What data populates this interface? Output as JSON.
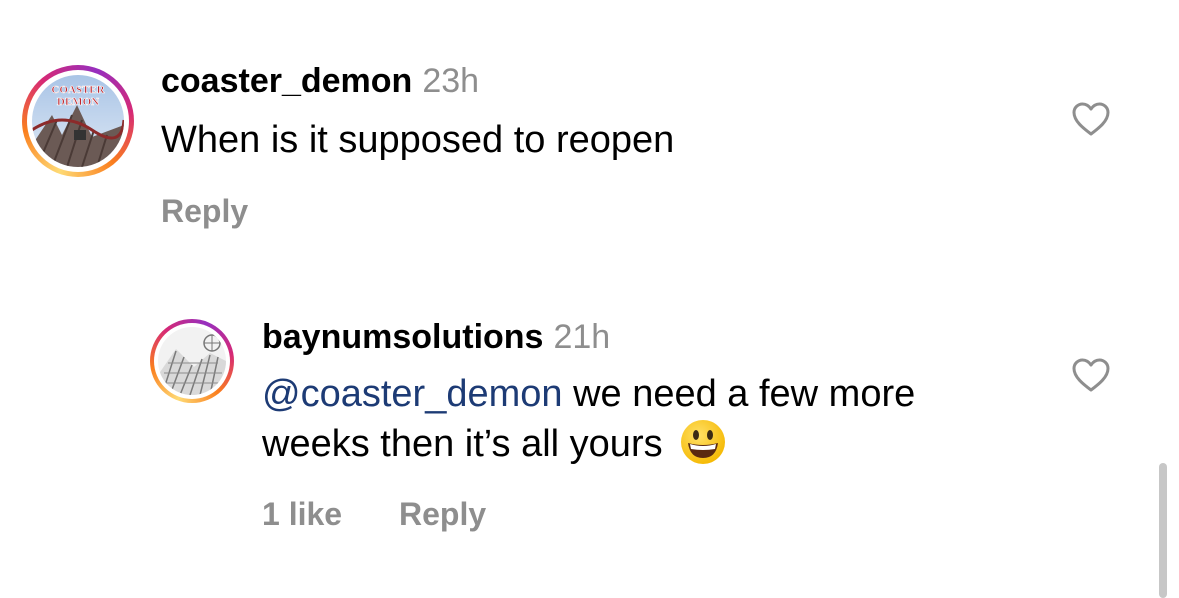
{
  "comments": [
    {
      "username": "coaster_demon",
      "time": "23h",
      "text": "When is it supposed to reopen",
      "reply_label": "Reply",
      "avatar_text": "COASTER DEMON"
    },
    {
      "username": "baynumsolutions",
      "time": "21h",
      "mention": "@coaster_demon",
      "text_line1": " we need a few more",
      "text_line2": "weeks then it’s all yours",
      "likes": "1 like",
      "reply_label": "Reply"
    }
  ],
  "colors": {
    "secondary_text": "#8e8e8e",
    "mention": "#1d3b75",
    "story_ring": [
      "#feda75",
      "#fa7e1e",
      "#d62976",
      "#962fbf"
    ]
  },
  "icons": {
    "like": "heart-outline-icon",
    "emoji": "grinning-face-emoji"
  }
}
